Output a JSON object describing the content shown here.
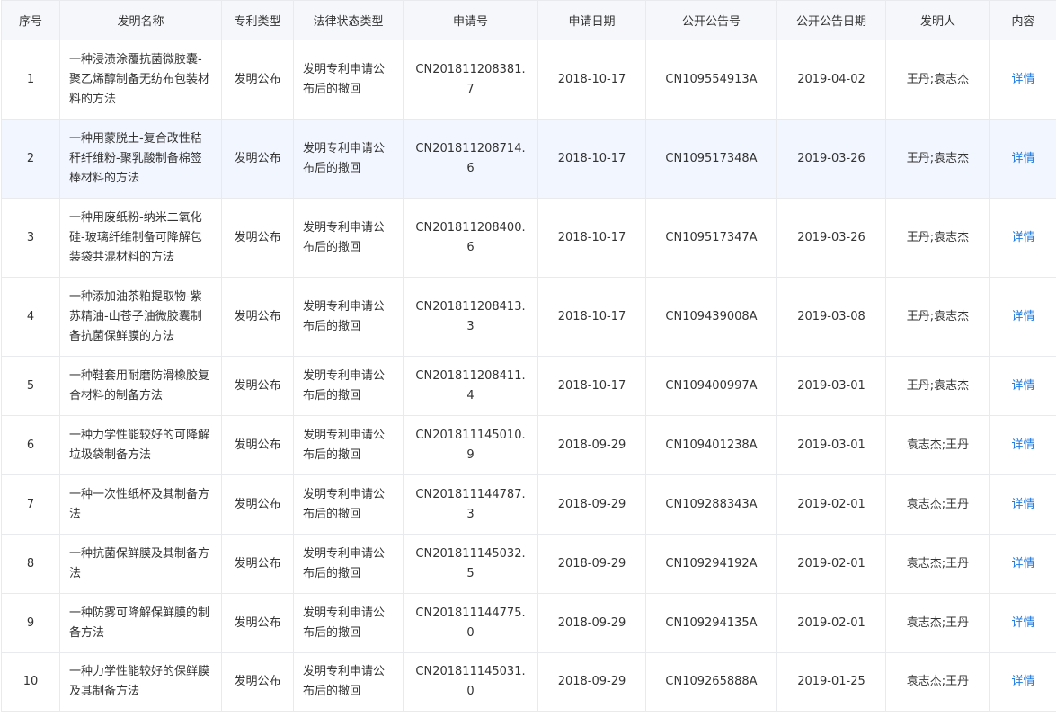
{
  "table": {
    "headers": [
      "序号",
      "发明名称",
      "专利类型",
      "法律状态类型",
      "申请号",
      "申请日期",
      "公开公告号",
      "公开公告日期",
      "发明人",
      "内容"
    ],
    "rows": [
      {
        "index": "1",
        "name": "一种浸渍涂覆抗菌微胶囊-聚乙烯醇制备无纺布包装材料的方法",
        "type": "发明公布",
        "status": "发明专利申请公布后的撤回",
        "app_no": "CN201811208381.7",
        "app_date": "2018-10-17",
        "pub_no": "CN109554913A",
        "pub_date": "2019-04-02",
        "inventor": "王丹;袁志杰",
        "detail": "详情"
      },
      {
        "index": "2",
        "name": "一种用蒙脱土-复合改性秸秆纤维粉-聚乳酸制备棉签棒材料的方法",
        "type": "发明公布",
        "status": "发明专利申请公布后的撤回",
        "app_no": "CN201811208714.6",
        "app_date": "2018-10-17",
        "pub_no": "CN109517348A",
        "pub_date": "2019-03-26",
        "inventor": "王丹;袁志杰",
        "detail": "详情"
      },
      {
        "index": "3",
        "name": "一种用废纸粉-纳米二氧化硅-玻璃纤维制备可降解包装袋共混材料的方法",
        "type": "发明公布",
        "status": "发明专利申请公布后的撤回",
        "app_no": "CN201811208400.6",
        "app_date": "2018-10-17",
        "pub_no": "CN109517347A",
        "pub_date": "2019-03-26",
        "inventor": "王丹;袁志杰",
        "detail": "详情"
      },
      {
        "index": "4",
        "name": "一种添加油茶粕提取物-紫苏精油-山苍子油微胶囊制备抗菌保鲜膜的方法",
        "type": "发明公布",
        "status": "发明专利申请公布后的撤回",
        "app_no": "CN201811208413.3",
        "app_date": "2018-10-17",
        "pub_no": "CN109439008A",
        "pub_date": "2019-03-08",
        "inventor": "王丹;袁志杰",
        "detail": "详情"
      },
      {
        "index": "5",
        "name": "一种鞋套用耐磨防滑橡胶复合材料的制备方法",
        "type": "发明公布",
        "status": "发明专利申请公布后的撤回",
        "app_no": "CN201811208411.4",
        "app_date": "2018-10-17",
        "pub_no": "CN109400997A",
        "pub_date": "2019-03-01",
        "inventor": "王丹;袁志杰",
        "detail": "详情"
      },
      {
        "index": "6",
        "name": "一种力学性能较好的可降解垃圾袋制备方法",
        "type": "发明公布",
        "status": "发明专利申请公布后的撤回",
        "app_no": "CN201811145010.9",
        "app_date": "2018-09-29",
        "pub_no": "CN109401238A",
        "pub_date": "2019-03-01",
        "inventor": "袁志杰;王丹",
        "detail": "详情"
      },
      {
        "index": "7",
        "name": "一种一次性纸杯及其制备方法",
        "type": "发明公布",
        "status": "发明专利申请公布后的撤回",
        "app_no": "CN201811144787.3",
        "app_date": "2018-09-29",
        "pub_no": "CN109288343A",
        "pub_date": "2019-02-01",
        "inventor": "袁志杰;王丹",
        "detail": "详情"
      },
      {
        "index": "8",
        "name": "一种抗菌保鲜膜及其制备方法",
        "type": "发明公布",
        "status": "发明专利申请公布后的撤回",
        "app_no": "CN201811145032.5",
        "app_date": "2018-09-29",
        "pub_no": "CN109294192A",
        "pub_date": "2019-02-01",
        "inventor": "袁志杰;王丹",
        "detail": "详情"
      },
      {
        "index": "9",
        "name": "一种防雾可降解保鲜膜的制备方法",
        "type": "发明公布",
        "status": "发明专利申请公布后的撤回",
        "app_no": "CN201811144775.0",
        "app_date": "2018-09-29",
        "pub_no": "CN109294135A",
        "pub_date": "2019-02-01",
        "inventor": "袁志杰;王丹",
        "detail": "详情"
      },
      {
        "index": "10",
        "name": "一种力学性能较好的保鲜膜及其制备方法",
        "type": "发明公布",
        "status": "发明专利申请公布后的撤回",
        "app_no": "CN201811145031.0",
        "app_date": "2018-09-29",
        "pub_no": "CN109265888A",
        "pub_date": "2019-01-25",
        "inventor": "袁志杰;王丹",
        "detail": "详情"
      }
    ]
  },
  "colors": {
    "header_bg": "#f5f7fa",
    "highlight_row_bg": "#f2f6fe",
    "border": "#e8eaee",
    "link": "#1f7ae0",
    "text": "#333333"
  }
}
